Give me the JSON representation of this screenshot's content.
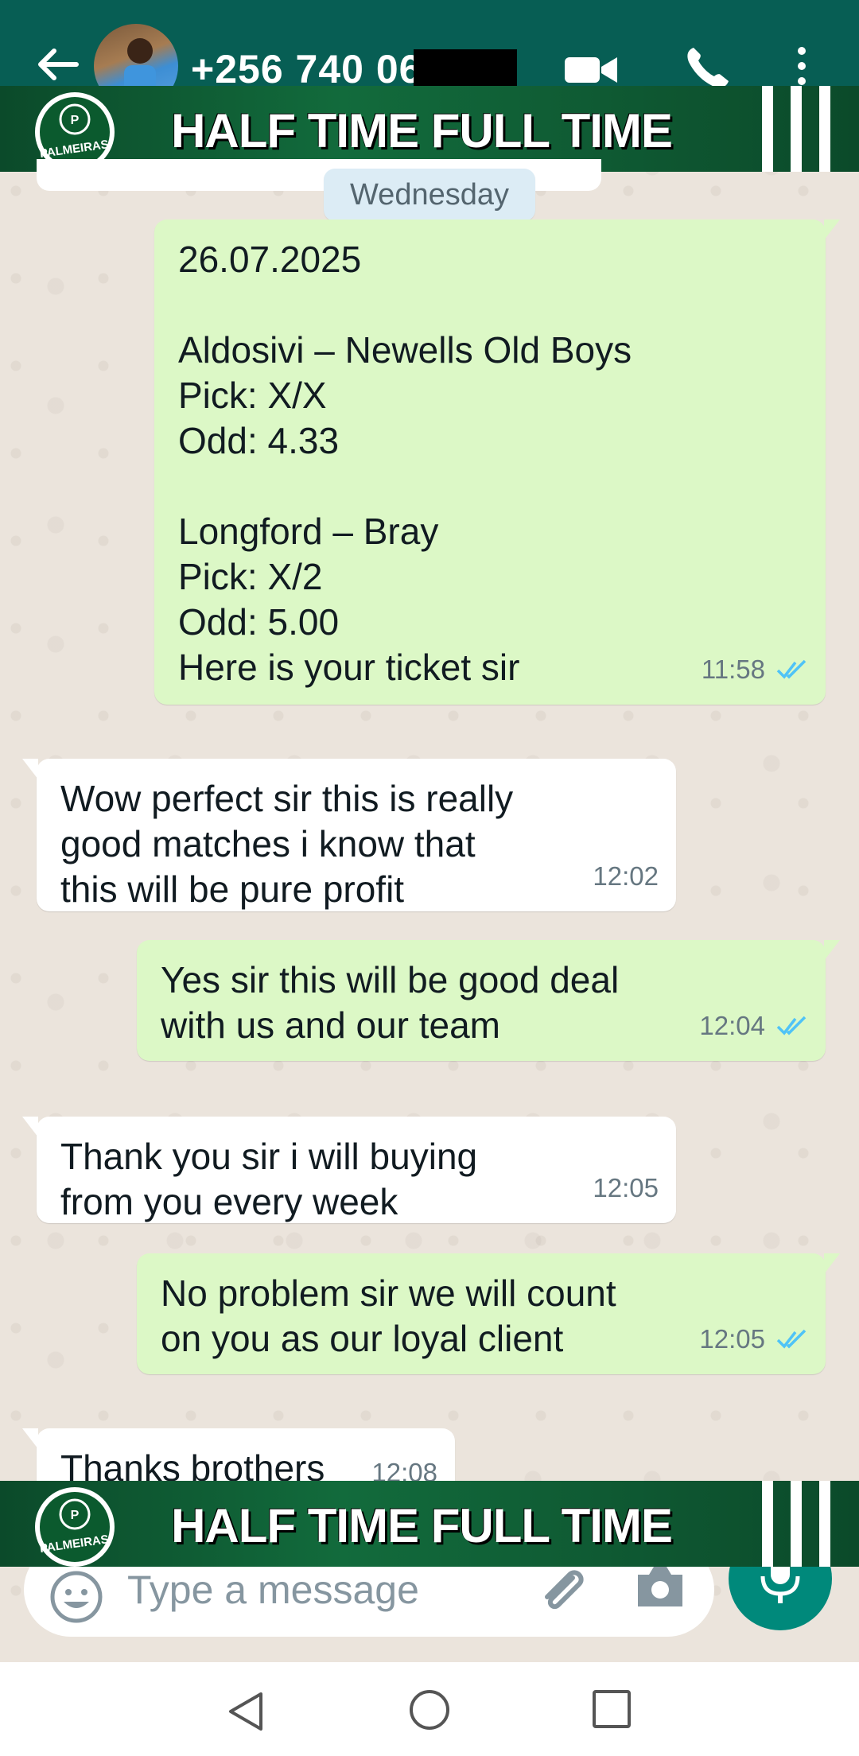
{
  "header": {
    "contact_name": "+256 740 06",
    "icons": [
      "back-arrow-icon",
      "video-call-icon",
      "phone-icon",
      "more-vert-icon"
    ]
  },
  "banner": {
    "title": "HALF TIME FULL TIME",
    "logo_text": "PALMEIRAS"
  },
  "date_separator": "Wednesday",
  "messages": [
    {
      "direction": "outgoing",
      "lines": [
        "26.07.2025",
        "",
        "Aldosivi – Newells Old Boys",
        "Pick: X/X",
        "Odd: 4.33",
        "",
        "Longford – Bray",
        "Pick: X/2",
        "Odd: 5.00",
        "Here is your ticket sir"
      ],
      "time": "11:58",
      "status": "read"
    },
    {
      "direction": "incoming",
      "lines": [
        "Wow perfect sir this is really",
        "good matches i know that",
        "this will be pure profit"
      ],
      "time": "12:02"
    },
    {
      "direction": "outgoing",
      "lines": [
        "Yes sir this will be good deal",
        "with us and our team"
      ],
      "time": "12:04",
      "status": "read"
    },
    {
      "direction": "incoming",
      "lines": [
        "Thank you sir i will buying",
        "from you every week"
      ],
      "time": "12:05"
    },
    {
      "direction": "outgoing",
      "lines": [
        "No problem sir we will count",
        "on you as our loyal client"
      ],
      "time": "12:05",
      "status": "read"
    },
    {
      "direction": "incoming",
      "lines": [
        "Thanks brothers"
      ],
      "time": "12:08"
    }
  ],
  "composer": {
    "placeholder": "Type a message",
    "icons": [
      "emoji-icon",
      "attach-icon",
      "camera-icon",
      "mic-icon"
    ]
  },
  "colors": {
    "header": "#075e54",
    "outgoing_bubble": "#dcf8c6",
    "incoming_bubble": "#ffffff",
    "read_ticks": "#4fc3f7",
    "mic_button": "#00897b",
    "banner": "#126b3c"
  }
}
